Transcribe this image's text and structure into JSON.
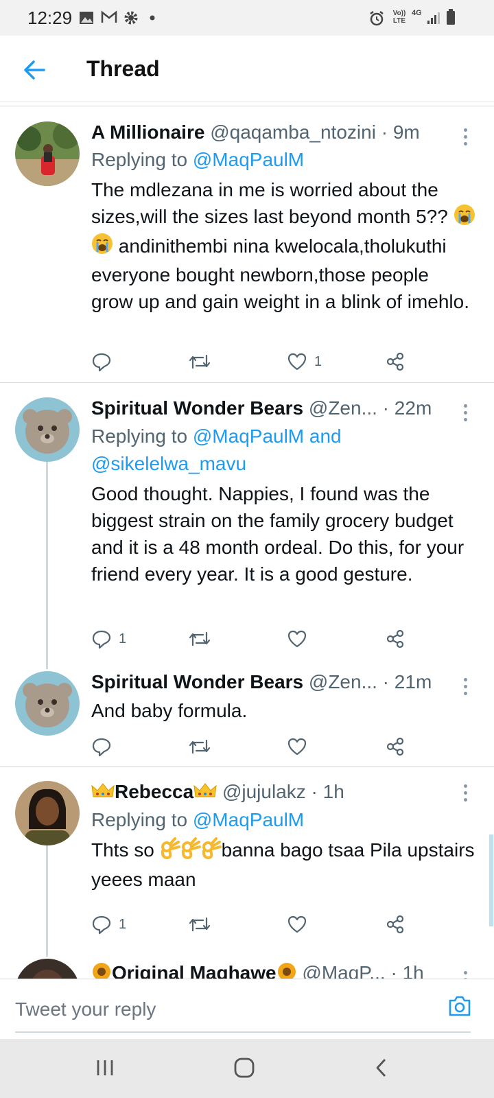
{
  "status_bar": {
    "time": "12:29",
    "net_volte": "Vo)) LTE",
    "net_4g": "4G"
  },
  "header": {
    "title": "Thread"
  },
  "tweets": [
    {
      "name": "A Millionaire",
      "handle": "@qaqamba_ntozini",
      "time": "9m",
      "replying_prefix": "Replying to ",
      "replying_to": "@MaqPaulM",
      "text_before": "The mdlezana in me is worried about the sizes,will the sizes last beyond month 5??",
      "text_after": " andinithembi nina kwelocala,tholukuthi everyone bought newborn,those people grow up and gain weight in a blink of imehlo.",
      "replies": "",
      "likes": "1"
    },
    {
      "name": "Spiritual Wonder Bears",
      "handle": "@Zen...",
      "time": "22m",
      "replying_prefix": "Replying to ",
      "replying_to": "@MaqPaulM and @sikelelwa_mavu",
      "text": "Good thought. Nappies, I found was the biggest strain on the family grocery budget and it is a 48 month ordeal. Do this, for your friend  every year. It is a good gesture.",
      "replies": "1",
      "likes": ""
    },
    {
      "name": "Spiritual Wonder Bears",
      "handle": "@Zen...",
      "time": "21m",
      "text": "And baby formula.",
      "replies": "",
      "likes": ""
    },
    {
      "name": "Rebecca",
      "handle": "@jujulakz",
      "time": "1h",
      "replying_prefix": "Replying to ",
      "replying_to": "@MaqPaulM",
      "text_before": "Thts so ",
      "text_after": "banna bago tsaa Pila upstairs yeees maan",
      "replies": "1",
      "likes": ""
    },
    {
      "name": "Original Maqhawe",
      "handle": "@MaqP...",
      "time": "1h"
    }
  ],
  "composer": {
    "placeholder": "Tweet your reply"
  },
  "colors": {
    "accent": "#1d9bf0",
    "text": "#0f1419",
    "muted": "#536471"
  },
  "icons": [
    "back-arrow-icon",
    "reply-icon",
    "retweet-icon",
    "like-icon",
    "share-icon",
    "more-icon",
    "camera-icon"
  ]
}
